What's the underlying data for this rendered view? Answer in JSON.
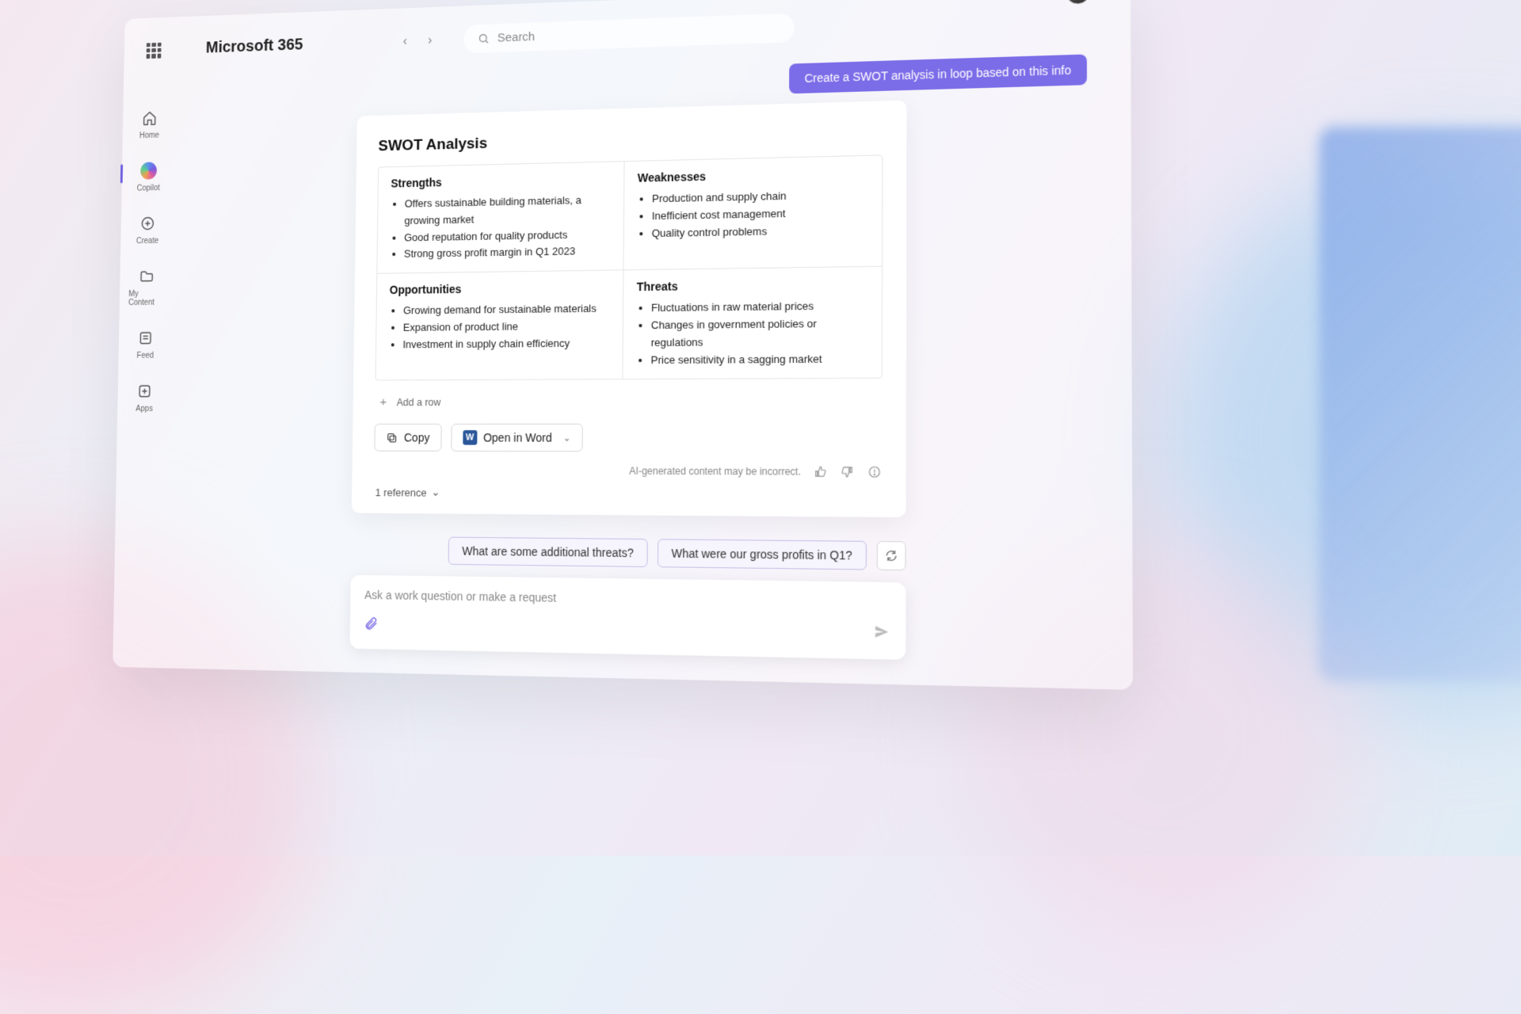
{
  "header": {
    "brand": "Microsoft 365",
    "search_placeholder": "Search"
  },
  "sidebar": {
    "items": [
      {
        "label": "Home"
      },
      {
        "label": "Copilot"
      },
      {
        "label": "Create"
      },
      {
        "label": "My Content"
      },
      {
        "label": "Feed"
      },
      {
        "label": "Apps"
      }
    ]
  },
  "conversation": {
    "user_prompt": "Create a SWOT analysis in loop based on this info",
    "response_title": "SWOT Analysis",
    "swot": {
      "strengths": {
        "heading": "Strengths",
        "items": [
          "Offers sustainable building materials, a growing market",
          "Good reputation for quality products",
          "Strong gross profit margin in Q1 2023"
        ]
      },
      "weaknesses": {
        "heading": "Weaknesses",
        "items": [
          "Production and supply chain",
          "Inefficient cost management",
          "Quality control problems"
        ]
      },
      "opportunities": {
        "heading": "Opportunities",
        "items": [
          "Growing demand for sustainable materials",
          "Expansion of product line",
          "Investment in supply chain efficiency"
        ]
      },
      "threats": {
        "heading": "Threats",
        "items": [
          "Fluctuations in raw material prices",
          "Changes in government policies or regulations",
          "Price sensitivity in a sagging market"
        ]
      }
    },
    "add_row": "Add a row",
    "copy_label": "Copy",
    "open_in_word_label": "Open in Word",
    "disclaimer": "AI-generated content may be incorrect.",
    "references": "1 reference",
    "suggestions": [
      "What are some additional threats?",
      "What were our gross profits in Q1?"
    ],
    "input_placeholder": "Ask a work question or make a request"
  }
}
